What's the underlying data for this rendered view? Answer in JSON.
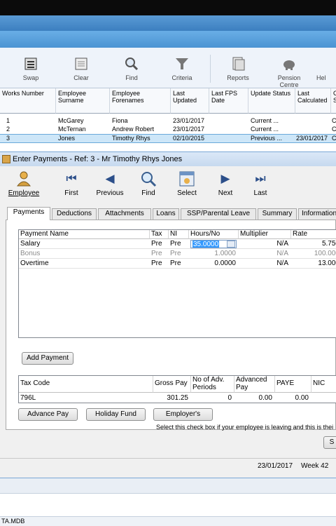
{
  "main_toolbar": {
    "items": [
      {
        "label": "Swap",
        "icon": "swap-icon",
        "enabled": false
      },
      {
        "label": "Clear",
        "icon": "clear-icon",
        "enabled": false
      },
      {
        "label": "Find",
        "icon": "find-icon",
        "enabled": false
      },
      {
        "label": "Criteria",
        "icon": "funnel-icon",
        "enabled": false
      },
      {
        "label": "Reports",
        "icon": "reports-icon",
        "enabled": false
      },
      {
        "label": "Pension Centre",
        "icon": "piggy-bank-icon",
        "enabled": false
      },
      {
        "label": "Hel",
        "icon": "help-icon",
        "enabled": false
      }
    ]
  },
  "employee_list": {
    "headers": [
      "Works Number",
      "Employee Surname",
      "Employee Forenames",
      "Last Updated",
      "Last FPS Date",
      "Update Status",
      "Last Calculated",
      "C S"
    ],
    "rows": [
      {
        "works": "1",
        "surname": "McGarey",
        "forenames": "Fiona",
        "updated": "23/01/2017",
        "fps": "",
        "status": "Current ...",
        "calc": "",
        "extra": "C"
      },
      {
        "works": "2",
        "surname": "McTernan",
        "forenames": "Andrew Robert",
        "updated": "23/01/2017",
        "fps": "",
        "status": "Current ...",
        "calc": "",
        "extra": "C"
      },
      {
        "works": "3",
        "surname": "Jones",
        "forenames": "Timothy Rhys",
        "updated": "02/10/2015",
        "fps": "",
        "status": "Previous ...",
        "calc": "23/01/2017",
        "extra": "C"
      }
    ]
  },
  "dialog": {
    "title": "Enter Payments - Ref: 3 - Mr Timothy Rhys Jones",
    "nav": [
      {
        "label": "Employee",
        "icon": "employee-icon"
      },
      {
        "label": "First",
        "icon": "first-icon"
      },
      {
        "label": "Previous",
        "icon": "previous-icon"
      },
      {
        "label": "Find",
        "icon": "find-icon"
      },
      {
        "label": "Select",
        "icon": "select-icon"
      },
      {
        "label": "Next",
        "icon": "next-icon"
      },
      {
        "label": "Last",
        "icon": "last-icon"
      }
    ],
    "tabs": [
      "Payments",
      "Deductions",
      "Attachments",
      "Loans",
      "SSP/Parental Leave",
      "Summary",
      "Information"
    ],
    "active_tab": "Payments",
    "payments": {
      "headers": [
        "Payment Name",
        "Tax",
        "NI",
        "Hours/No",
        "Multiplier",
        "Rate"
      ],
      "rows": [
        {
          "name": "Salary",
          "tax": "Pre",
          "ni": "Pre",
          "hours": "35.0000",
          "multiplier": "N/A",
          "rate": "5.750",
          "dim": false,
          "editing": true
        },
        {
          "name": "Bonus",
          "tax": "Pre",
          "ni": "Pre",
          "hours": "1.0000",
          "multiplier": "N/A",
          "rate": "100.000",
          "dim": true,
          "editing": false
        },
        {
          "name": "Overtime",
          "tax": "Pre",
          "ni": "Pre",
          "hours": "0.0000",
          "multiplier": "N/A",
          "rate": "13.000",
          "dim": false,
          "editing": false
        }
      ]
    },
    "add_payment_label": "Add Payment",
    "tax": {
      "headers": [
        "Tax Code",
        "Gross Pay",
        "No of Adv. Periods",
        "Advanced Pay",
        "PAYE",
        "NIC"
      ],
      "values": [
        "796L",
        "301.25",
        "0",
        "0.00",
        "0.00",
        ""
      ]
    },
    "buttons": {
      "advance_pay": "Advance Pay",
      "holiday_fund": "Holiday Fund",
      "employers": "Employer's",
      "partial_right": "S"
    },
    "leaver_note": "Select this check box if your employee is leaving and this is thei",
    "status": {
      "date": "23/01/2017",
      "week": "Week 42"
    }
  },
  "footer": {
    "filename": "TA.MDB"
  },
  "colors": {
    "selection": "#cde6f8",
    "title_bar": "#c6d9ef",
    "accent_blue": "#3c7fc0"
  }
}
